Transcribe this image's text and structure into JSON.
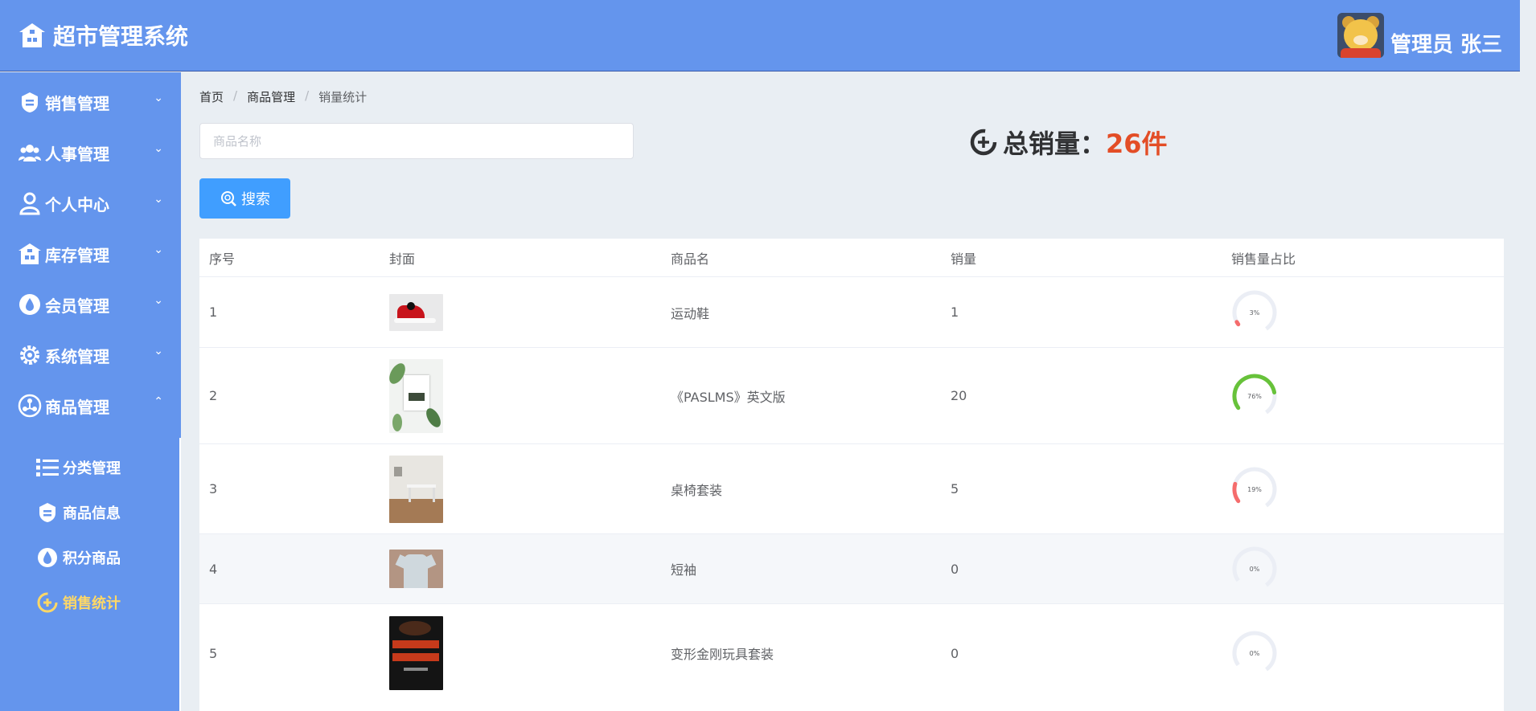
{
  "app": {
    "title": "超市管理系统",
    "user_label": "管理员 张三",
    "brand_color": "#6495ed",
    "accent_color": "#409eff"
  },
  "sidebar": {
    "items": [
      {
        "label": "销售管理",
        "icon": "sales-icon",
        "arrow": "⌄"
      },
      {
        "label": "人事管理",
        "icon": "people-icon",
        "arrow": "⌄"
      },
      {
        "label": "个人中心",
        "icon": "user-icon",
        "arrow": "⌄"
      },
      {
        "label": "库存管理",
        "icon": "warehouse-icon",
        "arrow": "⌄"
      },
      {
        "label": "会员管理",
        "icon": "member-icon",
        "arrow": "⌄"
      },
      {
        "label": "系统管理",
        "icon": "settings-icon",
        "arrow": "⌄"
      },
      {
        "label": "商品管理",
        "icon": "goods-icon",
        "arrow": "⌃"
      }
    ],
    "sub_items": [
      {
        "label": "分类管理",
        "icon": "list-icon"
      },
      {
        "label": "商品信息",
        "icon": "goods-info-icon"
      },
      {
        "label": "积分商品",
        "icon": "points-icon"
      },
      {
        "label": "销售统计",
        "icon": "stats-icon",
        "active": true
      }
    ]
  },
  "breadcrumb": [
    "首页",
    "商品管理",
    "销量统计"
  ],
  "search": {
    "placeholder": "商品名称",
    "value": "",
    "button_label": "搜索"
  },
  "summary": {
    "label": "总销量：",
    "value": "26件"
  },
  "table": {
    "columns": [
      "序号",
      "封面",
      "商品名",
      "销量",
      "销售量占比"
    ],
    "rows": [
      {
        "index": "1",
        "name": "运动鞋",
        "sales": "1",
        "percent": 3,
        "percent_label": "3%",
        "cover": "sneaker-image",
        "ring_color": "#f56c6c"
      },
      {
        "index": "2",
        "name": "《PASLMS》英文版",
        "sales": "20",
        "percent": 76,
        "percent_label": "76%",
        "cover": "book-image",
        "ring_color": "#67c23a"
      },
      {
        "index": "3",
        "name": "桌椅套装",
        "sales": "5",
        "percent": 19,
        "percent_label": "19%",
        "cover": "desk-chair-image",
        "ring_color": "#f56c6c"
      },
      {
        "index": "4",
        "name": "短袖",
        "sales": "0",
        "percent": 0,
        "percent_label": "0%",
        "cover": "tshirt-image",
        "ring_color": "#f56c6c"
      },
      {
        "index": "5",
        "name": "变形金刚玩具套装",
        "sales": "0",
        "percent": 0,
        "percent_label": "0%",
        "cover": "poster-image",
        "ring_color": "#f56c6c"
      }
    ]
  }
}
